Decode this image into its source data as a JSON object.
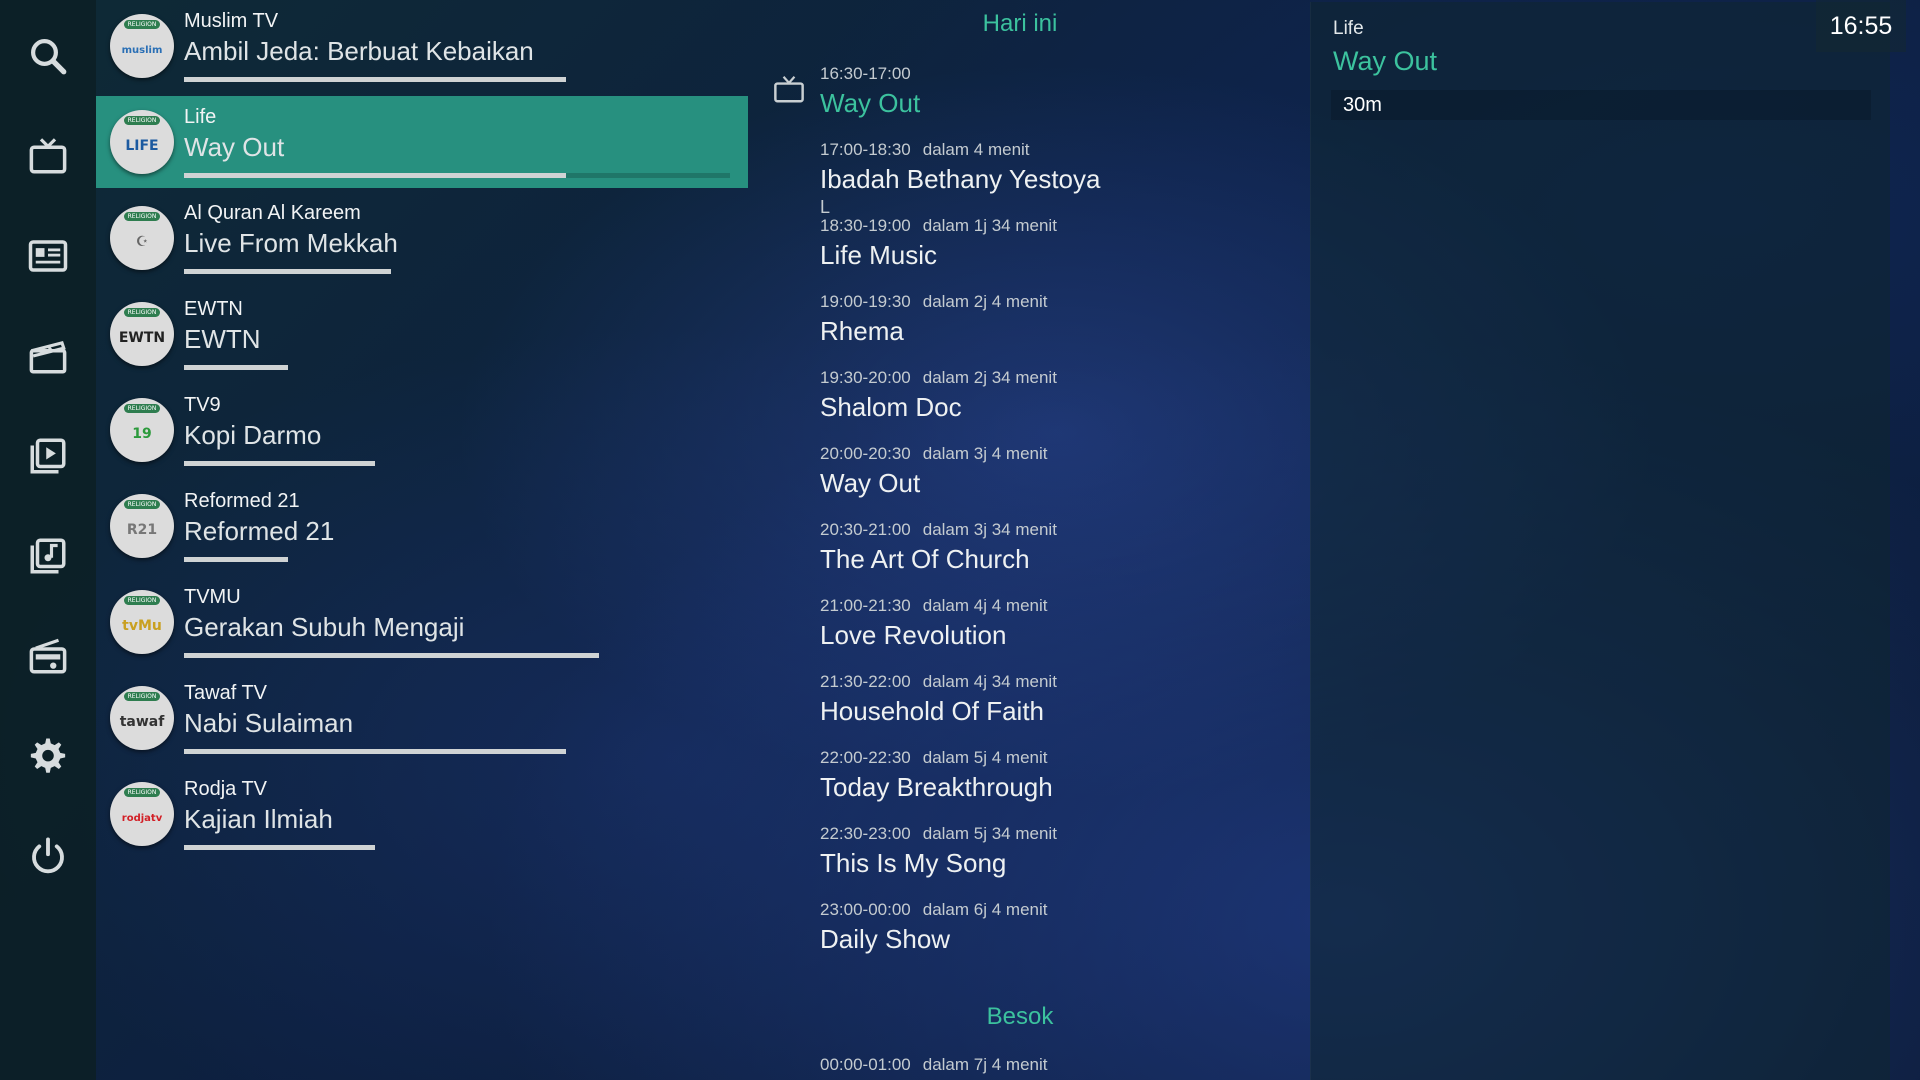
{
  "sidebar": {
    "items": [
      {
        "name": "search-icon"
      },
      {
        "name": "tv-icon"
      },
      {
        "name": "guide-icon"
      },
      {
        "name": "movie-icon"
      },
      {
        "name": "playlist-icon"
      },
      {
        "name": "music-library-icon"
      },
      {
        "name": "radio-icon"
      },
      {
        "name": "settings-icon"
      },
      {
        "name": "power-icon"
      }
    ]
  },
  "channels": [
    {
      "name": "Muslim TV",
      "program": "Ambil Jeda: Berbuat Kebaikan",
      "progress": 0.7,
      "logo_text": "muslim",
      "logo_color": "#2a6fb5",
      "tag": "RELIGION"
    },
    {
      "name": "Life",
      "program": "Way Out",
      "progress": 0.7,
      "logo_text": "LIFE",
      "logo_color": "#1c5aa0",
      "tag": "RELIGION"
    },
    {
      "name": "Al Quran Al Kareem",
      "program": "Live From Mekkah",
      "progress": 0.38,
      "logo_text": "☪",
      "logo_color": "#666666",
      "tag": "RELIGION"
    },
    {
      "name": "EWTN",
      "program": "EWTN",
      "progress": 0.19,
      "logo_text": "EWTN",
      "logo_color": "#222222",
      "tag": "RELIGION"
    },
    {
      "name": "TV9",
      "program": "Kopi Darmo",
      "progress": 0.35,
      "logo_text": "19",
      "logo_color": "#2c9a3c",
      "tag": "RELIGION"
    },
    {
      "name": "Reformed 21",
      "program": "Reformed 21",
      "progress": 0.19,
      "logo_text": "R21",
      "logo_color": "#777777",
      "tag": "RELIGION"
    },
    {
      "name": "TVMU",
      "program": "Gerakan Subuh Mengaji",
      "progress": 0.76,
      "logo_text": "tvMu",
      "logo_color": "#c9a020",
      "tag": "RELIGION"
    },
    {
      "name": "Tawaf TV",
      "program": "Nabi Sulaiman",
      "progress": 0.7,
      "logo_text": "tawaf",
      "logo_color": "#333333",
      "tag": "RELIGION"
    },
    {
      "name": "Rodja TV",
      "program": "Kajian Ilmiah",
      "progress": 0.35,
      "logo_text": "rodjatv",
      "logo_color": "#d21f26",
      "tag": "RELIGION"
    }
  ],
  "selected_channel_index": 1,
  "epg": {
    "today_label": "Hari ini",
    "tomorrow_label": "Besok",
    "today": [
      {
        "time": "16:30-17:00",
        "relative": "",
        "title": "Way Out",
        "extra": "",
        "current": true
      },
      {
        "time": "17:00-18:30",
        "relative": "dalam 4 menit",
        "title": "Ibadah Bethany Yestoya",
        "extra": "L"
      },
      {
        "time": "18:30-19:00",
        "relative": "dalam 1j 34 menit",
        "title": "Life Music",
        "extra": ""
      },
      {
        "time": "19:00-19:30",
        "relative": "dalam 2j 4 menit",
        "title": "Rhema",
        "extra": ""
      },
      {
        "time": "19:30-20:00",
        "relative": "dalam 2j 34 menit",
        "title": "Shalom Doc",
        "extra": ""
      },
      {
        "time": "20:00-20:30",
        "relative": "dalam 3j 4 menit",
        "title": "Way Out",
        "extra": ""
      },
      {
        "time": "20:30-21:00",
        "relative": "dalam 3j 34 menit",
        "title": "The Art Of Church",
        "extra": ""
      },
      {
        "time": "21:00-21:30",
        "relative": "dalam 4j 4 menit",
        "title": "Love Revolution",
        "extra": ""
      },
      {
        "time": "21:30-22:00",
        "relative": "dalam 4j 34 menit",
        "title": "Household Of Faith",
        "extra": ""
      },
      {
        "time": "22:00-22:30",
        "relative": "dalam 5j 4 menit",
        "title": "Today Breakthrough",
        "extra": ""
      },
      {
        "time": "22:30-23:00",
        "relative": "dalam 5j 34 menit",
        "title": "This Is My Song",
        "extra": ""
      },
      {
        "time": "23:00-00:00",
        "relative": "dalam 6j 4 menit",
        "title": "Daily Show",
        "extra": ""
      }
    ],
    "tomorrow": [
      {
        "time": "00:00-01:00",
        "relative": "dalam 7j 4 menit",
        "title": "",
        "extra": ""
      }
    ]
  },
  "detail": {
    "channel": "Life",
    "title": "Way Out",
    "duration": "30m"
  },
  "clock": "16:55",
  "colors": {
    "accent": "#3cc29e",
    "selected_bg": "#27907f",
    "sidebar_bg": "#0c2026"
  }
}
